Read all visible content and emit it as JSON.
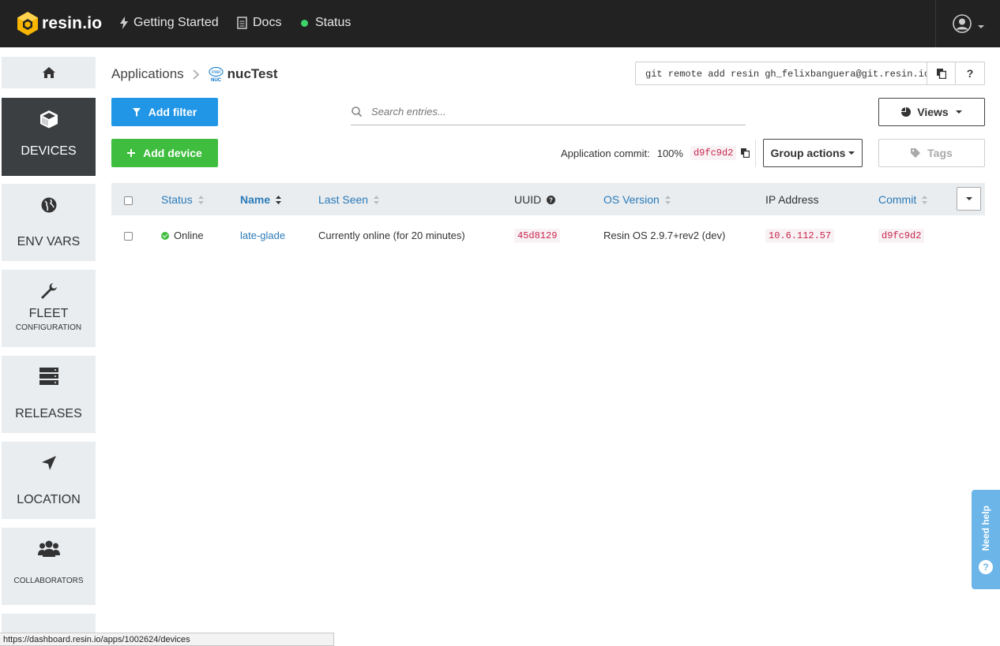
{
  "topbar": {
    "brand": "resin.io",
    "nav": [
      {
        "label": "Getting Started",
        "icon": "lightning-icon"
      },
      {
        "label": "Docs",
        "icon": "document-icon"
      },
      {
        "label": "Status",
        "icon": "status-dot"
      }
    ],
    "status_color": "#3dd36b"
  },
  "sidebar": {
    "items": [
      {
        "label": "",
        "icon": "home-icon"
      },
      {
        "label": "DEVICES",
        "icon": "cube-icon",
        "active": true
      },
      {
        "label": "ENV VARS",
        "icon": "globe-icon"
      },
      {
        "label": "FLEET",
        "sub": "CONFIGURATION",
        "icon": "wrench-icon"
      },
      {
        "label": "RELEASES",
        "icon": "server-icon"
      },
      {
        "label": "LOCATION",
        "icon": "location-arrow-icon"
      },
      {
        "label": "",
        "sub": "COLLABORATORS",
        "icon": "users-icon"
      }
    ]
  },
  "breadcrumb": {
    "root": "Applications",
    "separator": ">",
    "app": "nucTest",
    "device_logo": "intel-nuc-logo"
  },
  "git": {
    "command": "git remote add resin gh_felixbanguera@git.resin.io:gh",
    "copy_icon": "copy-icon",
    "help_label": "?"
  },
  "toolbar": {
    "add_filter": "Add filter",
    "add_device": "Add device",
    "search_placeholder": "Search entries...",
    "views": "Views",
    "group_actions": "Group actions",
    "tags": "Tags",
    "commit_label": "Application commit:",
    "commit_percent": "100%",
    "commit_hash": "d9fc9d2"
  },
  "table": {
    "columns": [
      "Status",
      "Name",
      "Last Seen",
      "UUID",
      "OS Version",
      "IP Address",
      "Commit"
    ],
    "rows": [
      {
        "status": "Online",
        "name": "late-glade",
        "last_seen": "Currently online (for 20 minutes)",
        "uuid": "45d8129",
        "os_version": "Resin OS 2.9.7+rev2 (dev)",
        "ip": "10.6.112.57",
        "commit": "d9fc9d2"
      }
    ]
  },
  "help_widget": {
    "label": "Need help",
    "badge": "?"
  },
  "statusbar": {
    "url": "https://dashboard.resin.io/apps/1002624/devices"
  },
  "colors": {
    "topbar": "#222222",
    "blue_button": "#2196e6",
    "green_button": "#3ebd3e",
    "link": "#2a7ab8",
    "code": "#c7254e"
  }
}
